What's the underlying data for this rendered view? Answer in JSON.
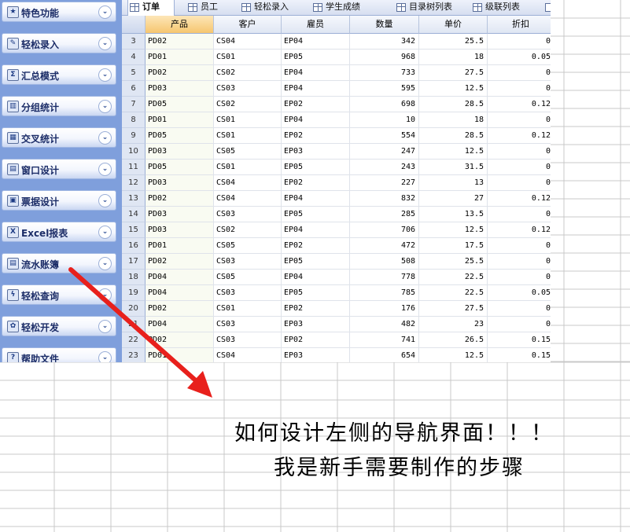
{
  "nav": {
    "items": [
      {
        "label": "特色功能",
        "icon": "star-scroll-icon",
        "glyph": "★",
        "cls": "ic-star"
      },
      {
        "label": "轻松录入",
        "icon": "edit-form-icon",
        "glyph": "✎",
        "cls": "ic-edit"
      },
      {
        "label": "汇总模式",
        "icon": "sigma-icon",
        "glyph": "Σ",
        "cls": "ic-sum"
      },
      {
        "label": "分组统计",
        "icon": "group-chart-icon",
        "glyph": "▥",
        "cls": "ic-grp"
      },
      {
        "label": "交叉统计",
        "icon": "crosstab-grid-icon",
        "glyph": "▦",
        "cls": "ic-cross"
      },
      {
        "label": "窗口设计",
        "icon": "window-icon",
        "glyph": "▤",
        "cls": "ic-win"
      },
      {
        "label": "票据设计",
        "icon": "receipt-icon",
        "glyph": "▣",
        "cls": "ic-bill"
      },
      {
        "label": "Excel报表",
        "icon": "excel-icon",
        "glyph": "X",
        "cls": "ic-xls"
      },
      {
        "label": "流水账簿",
        "icon": "ledger-book-icon",
        "glyph": "▤",
        "cls": "ic-book"
      },
      {
        "label": "轻松查询",
        "icon": "query-lightning-icon",
        "glyph": "ϟ",
        "cls": "ic-qry"
      },
      {
        "label": "轻松开发",
        "icon": "developer-puzzle-icon",
        "glyph": "✿",
        "cls": "ic-dev"
      },
      {
        "label": "帮助文件",
        "icon": "help-question-icon",
        "glyph": "?",
        "cls": "ic-help"
      }
    ],
    "chevron_glyph": "⌄"
  },
  "tabs": [
    {
      "label": "订单",
      "active": true
    },
    {
      "label": "员工",
      "active": false
    },
    {
      "label": "轻松录入",
      "active": false
    },
    {
      "label": "学生成绩",
      "active": false
    },
    {
      "label": "目录树列表",
      "active": false
    },
    {
      "label": "级联列表",
      "active": false
    }
  ],
  "table": {
    "headers": [
      "产品",
      "客户",
      "雇员",
      "数量",
      "单价",
      "折扣"
    ],
    "rows": [
      {
        "n": "3",
        "cells": [
          "PD02",
          "CS04",
          "EP04",
          "342",
          "25.5",
          "0"
        ]
      },
      {
        "n": "4",
        "cells": [
          "PD01",
          "CS01",
          "EP05",
          "968",
          "18",
          "0.05"
        ]
      },
      {
        "n": "5",
        "cells": [
          "PD02",
          "CS02",
          "EP04",
          "733",
          "27.5",
          "0"
        ]
      },
      {
        "n": "6",
        "cells": [
          "PD03",
          "CS03",
          "EP04",
          "595",
          "12.5",
          "0"
        ]
      },
      {
        "n": "7",
        "cells": [
          "PD05",
          "CS02",
          "EP02",
          "698",
          "28.5",
          "0.12"
        ]
      },
      {
        "n": "8",
        "cells": [
          "PD01",
          "CS01",
          "EP04",
          "10",
          "18",
          "0"
        ]
      },
      {
        "n": "9",
        "cells": [
          "PD05",
          "CS01",
          "EP02",
          "554",
          "28.5",
          "0.12"
        ]
      },
      {
        "n": "10",
        "cells": [
          "PD03",
          "CS05",
          "EP03",
          "247",
          "12.5",
          "0"
        ]
      },
      {
        "n": "11",
        "cells": [
          "PD05",
          "CS01",
          "EP05",
          "243",
          "31.5",
          "0"
        ]
      },
      {
        "n": "12",
        "cells": [
          "PD03",
          "CS04",
          "EP02",
          "227",
          "13",
          "0"
        ]
      },
      {
        "n": "13",
        "cells": [
          "PD02",
          "CS04",
          "EP04",
          "832",
          "27",
          "0.12"
        ]
      },
      {
        "n": "14",
        "cells": [
          "PD03",
          "CS03",
          "EP05",
          "285",
          "13.5",
          "0"
        ]
      },
      {
        "n": "15",
        "cells": [
          "PD03",
          "CS02",
          "EP04",
          "706",
          "12.5",
          "0.12"
        ]
      },
      {
        "n": "16",
        "cells": [
          "PD01",
          "CS05",
          "EP02",
          "472",
          "17.5",
          "0"
        ]
      },
      {
        "n": "17",
        "cells": [
          "PD02",
          "CS03",
          "EP05",
          "508",
          "25.5",
          "0"
        ]
      },
      {
        "n": "18",
        "cells": [
          "PD04",
          "CS05",
          "EP04",
          "778",
          "22.5",
          "0"
        ]
      },
      {
        "n": "19",
        "cells": [
          "PD04",
          "CS03",
          "EP05",
          "785",
          "22.5",
          "0.05"
        ]
      },
      {
        "n": "20",
        "cells": [
          "PD02",
          "CS01",
          "EP02",
          "176",
          "27.5",
          "0"
        ]
      },
      {
        "n": "21",
        "cells": [
          "PD04",
          "CS03",
          "EP03",
          "482",
          "23",
          "0"
        ]
      },
      {
        "n": "22",
        "cells": [
          "PD02",
          "CS03",
          "EP02",
          "741",
          "26.5",
          "0.15"
        ]
      },
      {
        "n": "23",
        "cells": [
          "PD01",
          "CS04",
          "EP03",
          "654",
          "12.5",
          "0.15"
        ]
      }
    ]
  },
  "message": {
    "line1": "如何设计左侧的导航界面！！！",
    "line2": "我是新手需要制作的步骤"
  },
  "colors": {
    "nav_bg": "#7f9fdc",
    "arrow": "#e8201c",
    "grid_line": "#c8c8c8",
    "selected_header": "#f6c66f"
  }
}
